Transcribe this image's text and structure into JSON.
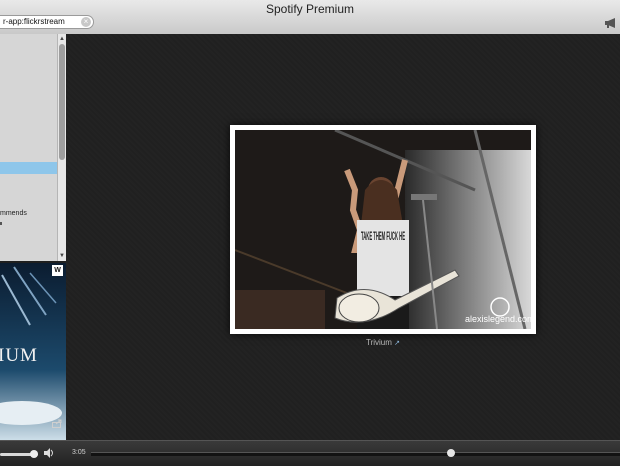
{
  "window": {
    "title": "Spotify Premium"
  },
  "search": {
    "value": "r-app:flickrstream",
    "clear_glyph": "×"
  },
  "toolbar": {
    "announce_icon": "megaphone-icon"
  },
  "sidebar": {
    "items": [
      {
        "label": "mmends"
      }
    ],
    "scroll_up_glyph": "▲",
    "scroll_down_glyph": "▼"
  },
  "album": {
    "title": "IUM",
    "label_badge": "W",
    "share_icon": "share-icon"
  },
  "main": {
    "caption": "Trivium",
    "external_link_glyph": "↗",
    "photo": {
      "shirt_text": "TAKE THEM FUCK HE",
      "watermark": "alexislegend.com"
    }
  },
  "player": {
    "elapsed": "3:05",
    "volume": 0.9,
    "progress": 0.68
  },
  "colors": {
    "selection": "#8ec6ea",
    "background": "#202020"
  }
}
